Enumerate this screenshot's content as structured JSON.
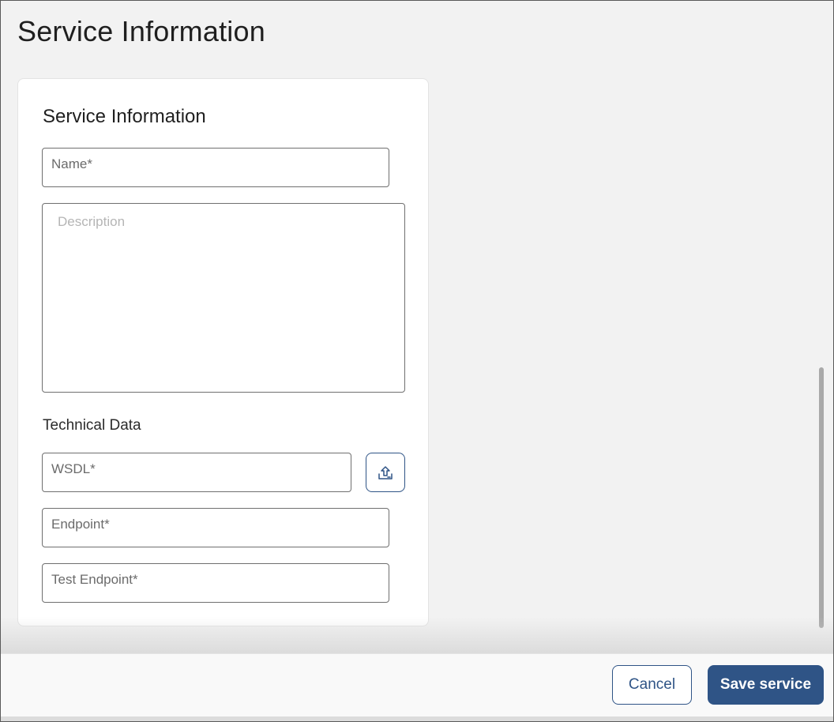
{
  "page": {
    "title": "Service Information"
  },
  "card": {
    "title": "Service Information",
    "name_field": {
      "label": "Name*",
      "value": ""
    },
    "description_field": {
      "placeholder": "Description",
      "value": ""
    },
    "technical_section": {
      "label": "Technical Data"
    },
    "wsdl_field": {
      "label": "WSDL*",
      "value": ""
    },
    "upload_button": {
      "icon": "upload-icon"
    },
    "endpoint_field": {
      "label": "Endpoint*",
      "value": ""
    },
    "test_endpoint_field": {
      "label": "Test Endpoint*",
      "value": ""
    }
  },
  "footer": {
    "cancel_label": "Cancel",
    "save_label": "Save service"
  },
  "colors": {
    "primary": "#2f5486",
    "background": "#f2f2f2",
    "card": "#ffffff"
  }
}
